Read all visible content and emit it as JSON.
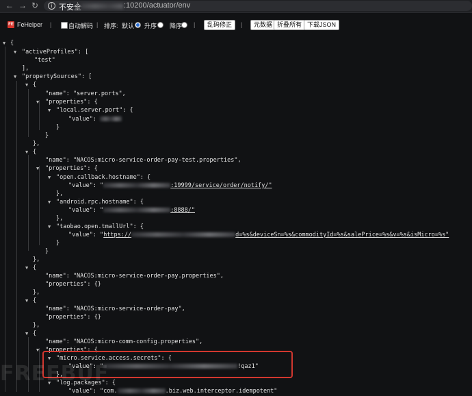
{
  "browser": {
    "back_glyph": "←",
    "forward_glyph": "→",
    "reload_glyph": "↻",
    "security_label": "不安全",
    "url_visible": ":10200/actuator/env"
  },
  "fehelper": {
    "brand": "FeHelper",
    "logo_text": "FE",
    "divider": "|",
    "auto_decode_label": "自动解码",
    "sort_label": "排序:",
    "sort_options": [
      "默认",
      "升序",
      "降序"
    ],
    "sort_selected": "默认",
    "fix_garbled_button": "乱码修正",
    "raw_data_button": "元数据",
    "collapse_all_button": "折叠所有",
    "download_json_button": "下载JSON"
  },
  "json_lines": {
    "l1": "{",
    "l2": "\"activeProfiles\": [",
    "l3": "\"test\"",
    "l4": "],",
    "l5": "\"propertySources\": [",
    "l6": "{",
    "l7": "\"name\": \"server.ports\",",
    "l8": "\"properties\": {",
    "l9": "\"local.server.port\": {",
    "l10": "\"value\":",
    "l11": "}",
    "l12": "}",
    "l13": "},",
    "l14": "{",
    "l15": "\"name\": \"NACOS:micro-service-order-pay-test.properties\",",
    "l16": "\"properties\": {",
    "l17": "\"open.callback.hostname\": {",
    "l18a": "\"value\": \"",
    "l18b": ":19999/service/order/notify/\"",
    "l19": "},",
    "l20": "\"android.rpc.hostname\": {",
    "l21a": "\"value\": \"",
    "l21b": ":8888/\"",
    "l22": "},",
    "l23": "\"taobao.open.tmallUrl\": {",
    "l24a": "\"value\": \"",
    "l24b": "https://",
    "l24c": "d=%s&deviceSn=%s&commodityId=%s&salePrice=%s&v=%s&isMicro=%s\"",
    "l25": "}",
    "l26": "}",
    "l27": "},",
    "l28": "{",
    "l29": "\"name\": \"NACOS:micro-service-order-pay.properties\",",
    "l30": "\"properties\": {}",
    "l31": "},",
    "l32": "{",
    "l33": "\"name\": \"NACOS:micro-service-order-pay\",",
    "l34": "\"properties\": {}",
    "l35": "},",
    "l36": "{",
    "l37": "\"name\": \"NACOS:micro-comm-config.properties\",",
    "l38": "\"properties\": {",
    "l39": "\"micro.service.access.secrets\": {",
    "l40a": "\"value\": \"",
    "l40b": "!qaz1\"",
    "l41": "},",
    "l42": "\"log.packages\": {",
    "l43a": "\"value\": \"com.",
    "l43b": ".biz.web.interceptor.idempotent\""
  },
  "watermark": "FREEBUF"
}
